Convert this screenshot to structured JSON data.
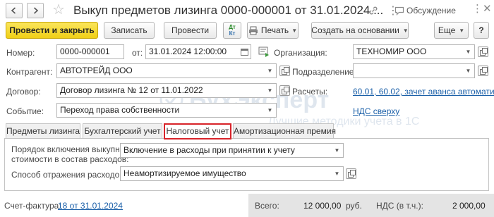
{
  "window": {
    "title": "Выкуп предметов лизинга 0000-000001 от 31.01.2024 ...",
    "more_icon": "⋮",
    "discussion_label": "Обсуждение"
  },
  "toolbar": {
    "post_close_label": "Провести и закрыть",
    "save_label": "Записать",
    "post_label": "Провести",
    "dt_kt_label_top": "Дт",
    "dt_kt_label_bottom": "Кт",
    "print_label": "Печать",
    "create_based_label": "Создать на основании",
    "more_label": "Еще",
    "help_label": "?"
  },
  "form": {
    "number_label": "Номер:",
    "number_value": "0000-000001",
    "date_label": "от:",
    "date_value": "31.01.2024 12:00:00",
    "organization_label": "Организация:",
    "organization_value": "ТЕХНОМИР ООО",
    "contractor_label": "Контрагент:",
    "contractor_value": "АВТОТРЕЙД ООО",
    "division_label": "Подразделение:",
    "division_value": "",
    "contract_label": "Договор:",
    "contract_value": "Договор лизинга № 12 от 11.01.2022",
    "settlements_label": "Расчеты:",
    "settlements_link": "60.01, 60.02, зачет аванса автомати...",
    "event_label": "Событие:",
    "event_value": "Переход права собственности",
    "vat_link": "НДС сверху"
  },
  "tabs": [
    {
      "label": "Предметы лизинга"
    },
    {
      "label": "Бухгалтерский учет"
    },
    {
      "label": "Налоговый учет"
    },
    {
      "label": "Амортизационная премия"
    }
  ],
  "tax_tab": {
    "inclusion_label_line1": "Порядок включения выкупной",
    "inclusion_label_line2": "стоимости в состав расходов:",
    "inclusion_value": "Включение в расходы при принятии к учету",
    "expense_method_label": "Способ отражения расходов:",
    "expense_method_value": "Неамортизируемое имущество"
  },
  "footer": {
    "invoice_label": "Счет-фактура:",
    "invoice_link": "18 от 31.01.2024",
    "total_label": "Всего:",
    "total_value": "12 000,00",
    "currency": "руб.",
    "vat_label": "НДС (в т.ч.):",
    "vat_value": "2 000,00"
  },
  "watermark": {
    "brand": "БухЭксперт",
    "tagline": "Лучшие методики учета в 1С"
  },
  "colors": {
    "primary_button": "#f0cf16",
    "link": "#1a5fa8",
    "active_tab_border": "#d8232a",
    "footer_bg": "#e4e4e4"
  }
}
